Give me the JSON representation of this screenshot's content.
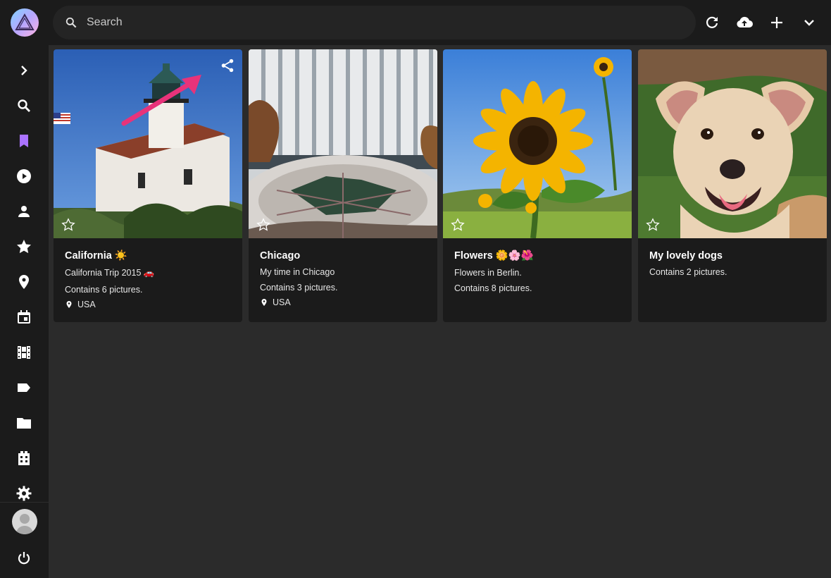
{
  "search": {
    "placeholder": "Search"
  },
  "toolbar": {
    "reload": "reload-icon",
    "upload": "cloud-upload-icon",
    "add": "plus-icon",
    "expand": "chevron-down-icon"
  },
  "sidebar": {
    "items": [
      "expand",
      "search",
      "albums",
      "videos",
      "people",
      "favorites",
      "places",
      "calendar",
      "moments",
      "labels",
      "folders",
      "library",
      "settings"
    ],
    "logout": "power-icon"
  },
  "albums": [
    {
      "title": "California ☀️",
      "description": "California Trip 2015 🚗",
      "count": "Contains 6 pictures.",
      "location": "USA"
    },
    {
      "title": "Chicago",
      "description": "My time in Chicago",
      "count": "Contains 3 pictures.",
      "location": "USA"
    },
    {
      "title": "Flowers 🌼🌸🌺",
      "description": "Flowers in Berlin.",
      "count": "Contains 8 pictures."
    },
    {
      "title": "My lovely dogs",
      "description": "Contains 2 pictures."
    }
  ],
  "colors": {
    "accent": "#ab73ff",
    "arrow": "#e8337a",
    "bg": "#2b2b2b",
    "panel": "#1b1b1b"
  }
}
